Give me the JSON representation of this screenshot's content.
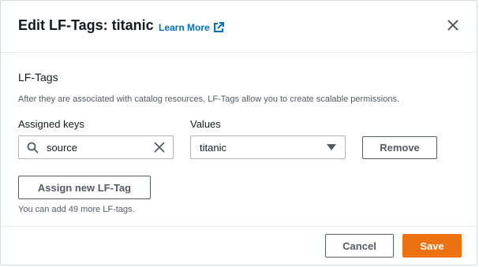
{
  "modal": {
    "title": "Edit LF-Tags: titanic",
    "learn_more": "Learn More",
    "close_icon": "close-icon"
  },
  "form": {
    "section_label": "LF-Tags",
    "section_description": "After they are associated with catalog resources, LF-Tags allow you to create scalable permissions.",
    "assigned_keys_label": "Assigned keys",
    "values_label": "Values",
    "key_input_value": "source",
    "value_selected": "titanic",
    "remove_label": "Remove",
    "assign_new_label": "Assign new LF-Tag",
    "limit_note": "You can add 49 more LF-tags."
  },
  "footer": {
    "cancel_label": "Cancel",
    "save_label": "Save"
  },
  "colors": {
    "link": "#0073bb",
    "primary": "#ec7211",
    "text": "#16191f",
    "secondary_text": "#545b64"
  }
}
